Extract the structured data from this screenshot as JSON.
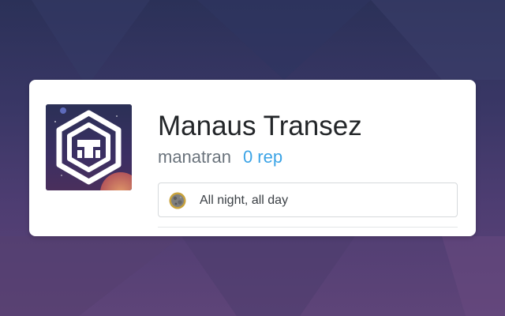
{
  "profile": {
    "display_name": "Manaus Transez",
    "username": "manatran",
    "reputation": "0 rep",
    "status_text": "All night, all day",
    "avatar_icon": "hexagon-logo-icon",
    "status_icon": "moon-icon"
  },
  "colors": {
    "background_top": "#2b3158",
    "background_bottom": "#5e4478",
    "card": "#ffffff",
    "name": "#232629",
    "username": "#6a737c",
    "reputation": "#3ca4e6"
  }
}
